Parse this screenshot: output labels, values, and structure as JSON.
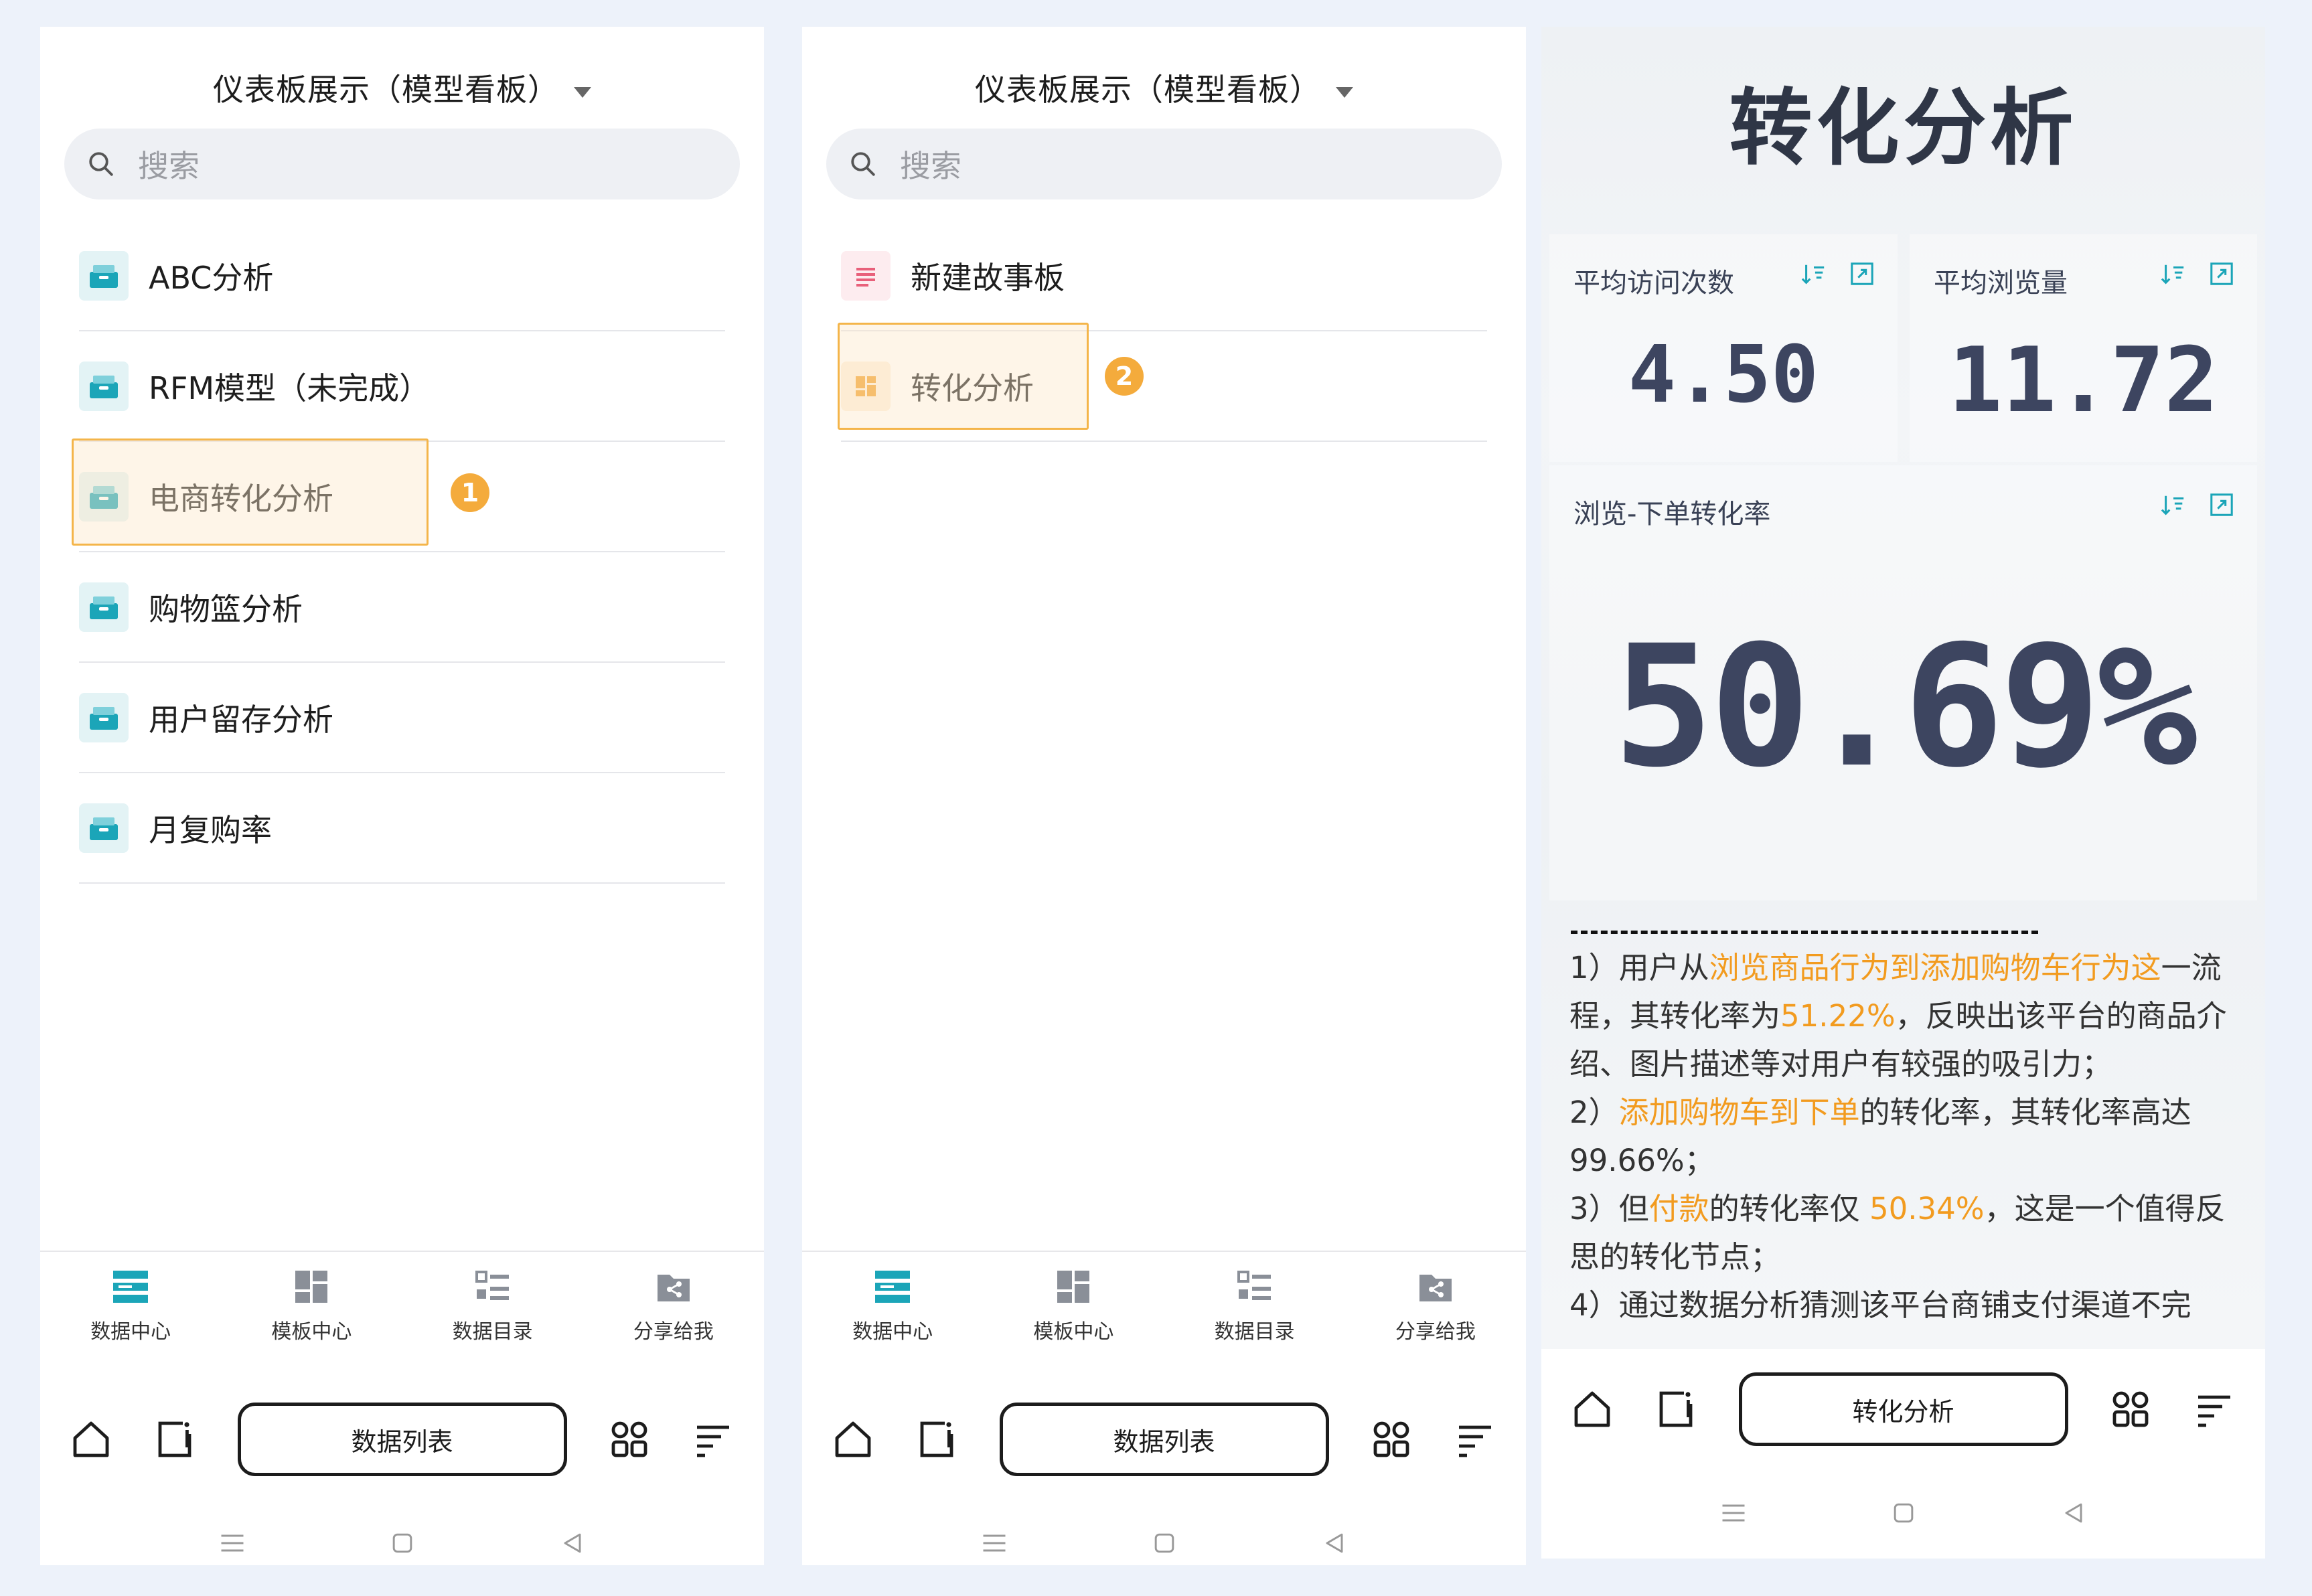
{
  "screen1": {
    "title": "仪表板展示（模型看板）",
    "search_placeholder": "搜索",
    "items": [
      {
        "label": "ABC分析"
      },
      {
        "label": "RFM模型（未完成）"
      },
      {
        "label": "电商转化分析"
      },
      {
        "label": "购物篮分析"
      },
      {
        "label": "用户留存分析"
      },
      {
        "label": "月复购率"
      }
    ],
    "step_badge": "1",
    "tabs": [
      {
        "label": "数据中心",
        "icon": "data-center-icon"
      },
      {
        "label": "模板中心",
        "icon": "template-center-icon"
      },
      {
        "label": "数据目录",
        "icon": "data-catalog-icon"
      },
      {
        "label": "分享给我",
        "icon": "shared-with-me-icon"
      }
    ],
    "pill_label": "数据列表"
  },
  "screen2": {
    "title": "仪表板展示（模型看板）",
    "search_placeholder": "搜索",
    "items": [
      {
        "label": "新建故事板"
      },
      {
        "label": "转化分析"
      }
    ],
    "step_badge": "2",
    "tabs": [
      {
        "label": "数据中心",
        "icon": "data-center-icon"
      },
      {
        "label": "模板中心",
        "icon": "template-center-icon"
      },
      {
        "label": "数据目录",
        "icon": "data-catalog-icon"
      },
      {
        "label": "分享给我",
        "icon": "shared-with-me-icon"
      }
    ],
    "pill_label": "数据列表"
  },
  "screen3": {
    "title": "转化分析",
    "kpis": [
      {
        "title": "平均访问次数",
        "value": "4.50"
      },
      {
        "title": "平均浏览量",
        "value": "11.72"
      },
      {
        "title": "浏览-下单转化率",
        "value": "50.69%"
      }
    ],
    "text": {
      "p1_a": "1）用户从",
      "p1_hl": "浏览商品行为到添加购物车行为这",
      "p1_b": "一流程，其转化率为",
      "p1_hl2": "51.22%",
      "p1_c": "，反映出该平台的商品介绍、图片描述等对用户有较强的吸引力；",
      "p2_a": "2）",
      "p2_hl": "添加购物车到下单",
      "p2_b": "的转化率，其转化率高达99.66%；",
      "p3_a": "3）但",
      "p3_hl": "付款",
      "p3_b": "的转化率仅 ",
      "p3_hl2": "50.34%",
      "p3_c": "，这是一个值得反思的转化节点；",
      "p4_a": "4）通过数据分析猜测该平台商铺支付渠道不完"
    },
    "pill_label": "转化分析"
  },
  "colors": {
    "accent_teal": "#1ba5b8",
    "highlight_orange": "#f4ab3c",
    "text_highlight": "#f29b1f"
  }
}
